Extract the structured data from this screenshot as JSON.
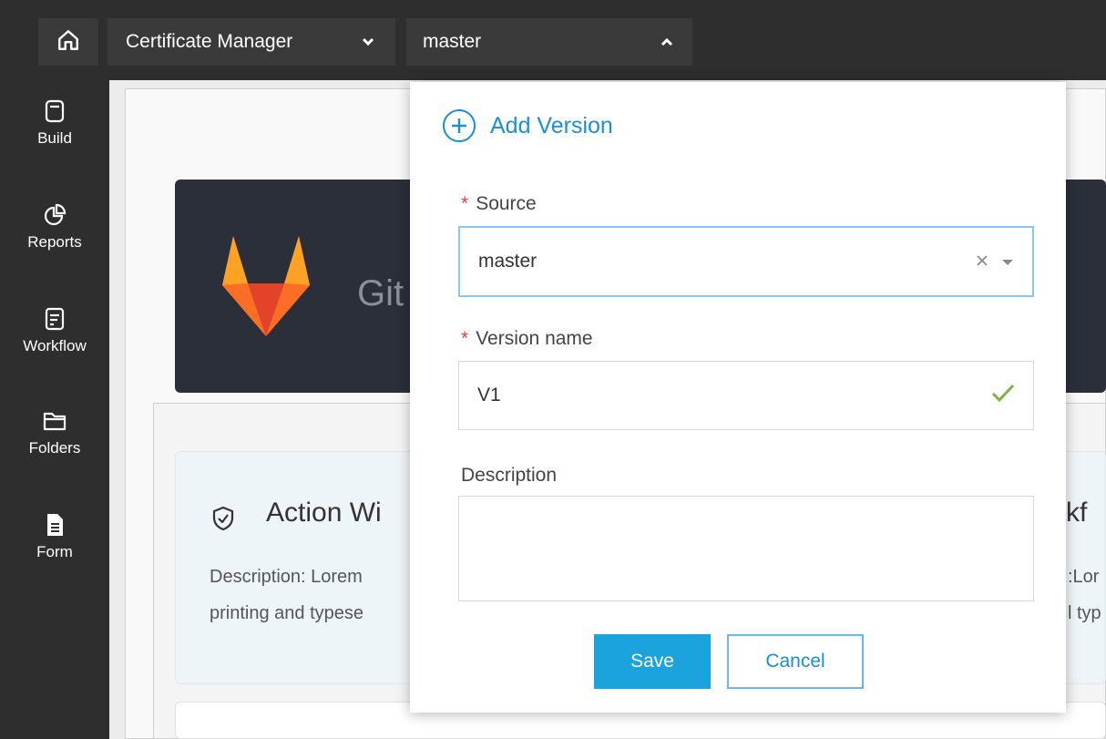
{
  "topbar": {
    "home_icon": "home-icon",
    "app_select": {
      "value": "Certificate Manager",
      "icon": "chevron-down-icon"
    },
    "branch_select": {
      "value": "master",
      "icon": "chevron-up-icon"
    }
  },
  "sidebar": {
    "items": [
      {
        "label": "Build",
        "icon": "build-icon"
      },
      {
        "label": "Reports",
        "icon": "reports-icon"
      },
      {
        "label": "Workflow",
        "icon": "workflow-icon"
      },
      {
        "label": "Folders",
        "icon": "folder-icon"
      },
      {
        "label": "Form",
        "icon": "form-icon"
      }
    ]
  },
  "background": {
    "banner_text": "Git",
    "widget_title": "Action Wi",
    "widget_right_title": "rkf",
    "desc_line_1_left": "Description: Lorem",
    "desc_line_2_left": "printing and typese",
    "desc_line_1_right": ":Lor",
    "desc_line_2_right": "l typ"
  },
  "popover": {
    "add_version_label": "Add Version",
    "source": {
      "label": "Source",
      "required_mark": "*",
      "value": "master"
    },
    "version_name": {
      "label": "Version name",
      "required_mark": "*",
      "value": "V1"
    },
    "description": {
      "label": "Description",
      "value": ""
    },
    "save_label": "Save",
    "cancel_label": "Cancel"
  },
  "colors": {
    "accent": "#1aa3dd",
    "link": "#1a8fd8",
    "required": "#e83e3e",
    "valid": "#7cb342",
    "dark_bar": "#2e2e2e"
  }
}
